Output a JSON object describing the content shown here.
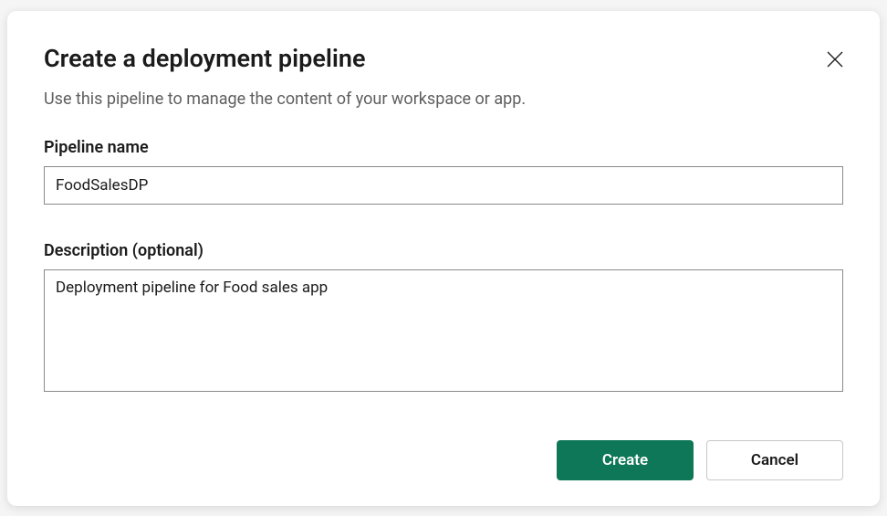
{
  "dialog": {
    "title": "Create a deployment pipeline",
    "subtitle": "Use this pipeline to manage the content of your workspace or app."
  },
  "fields": {
    "name": {
      "label": "Pipeline name",
      "value": "FoodSalesDP"
    },
    "description": {
      "label": "Description (optional)",
      "value": "Deployment pipeline for Food sales app"
    }
  },
  "buttons": {
    "create": "Create",
    "cancel": "Cancel"
  },
  "colors": {
    "primary": "#0d7757"
  }
}
